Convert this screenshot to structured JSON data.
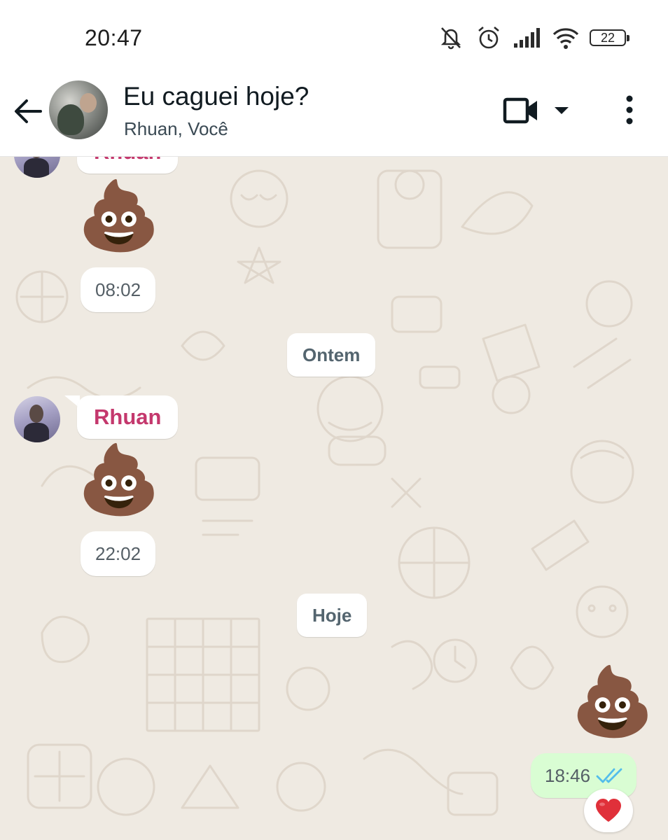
{
  "status_bar": {
    "time": "20:47",
    "battery": "22",
    "icons": [
      "mute-icon",
      "alarm-icon",
      "signal-icon",
      "wifi-icon",
      "battery-icon"
    ]
  },
  "header": {
    "title": "Eu caguei hoje?",
    "subtitle": "Rhuan, Você",
    "icons": [
      "back-arrow-icon",
      "video-call-icon",
      "dropdown-caret-icon",
      "more-vert-icon"
    ]
  },
  "messages": [
    {
      "sender": "Rhuan",
      "content": "💩",
      "time": "08:02",
      "partial": true
    },
    {
      "date_separator": "Ontem"
    },
    {
      "sender": "Rhuan",
      "content": "💩",
      "time": "22:02"
    },
    {
      "date_separator": "Hoje"
    },
    {
      "outgoing": true,
      "content": "💩",
      "time": "18:46",
      "status": "read",
      "reaction": "❤️"
    }
  ],
  "colors": {
    "sender_name": "#c4386d",
    "chat_background": "#efeae2",
    "outgoing_bubble": "#d9fdd3",
    "read_ticks": "#53bdeb"
  }
}
